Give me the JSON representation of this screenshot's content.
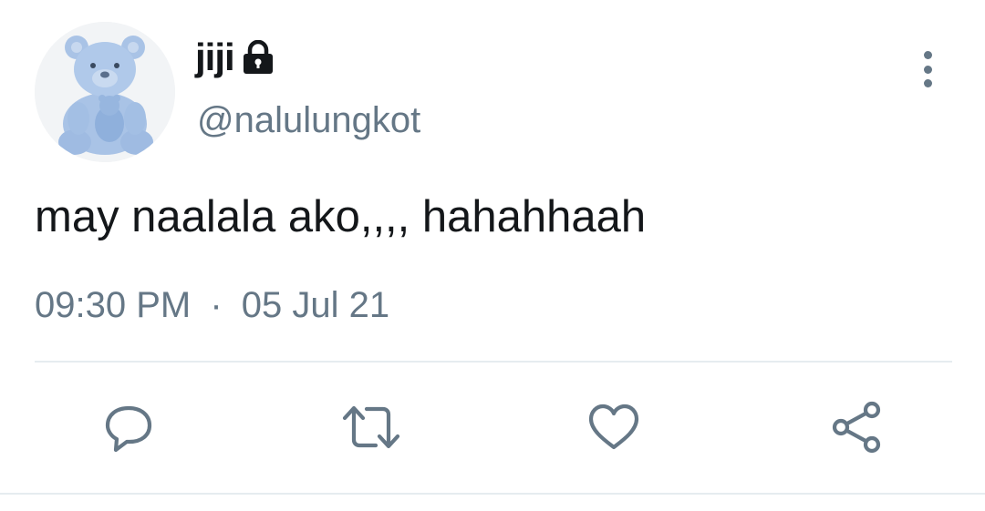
{
  "author": {
    "display_name": "jiji",
    "handle": "@nalulungkot",
    "protected_icon": "lock-icon",
    "avatar_desc_icon": "teddy-bear-avatar"
  },
  "tweet": {
    "text": "may naalala ako,,,, hahahhaah",
    "time": "09:30 PM",
    "separator": "·",
    "date": "05 Jul 21"
  },
  "actions": [
    {
      "name": "reply",
      "icon": "comment-icon"
    },
    {
      "name": "retweet",
      "icon": "retweet-icon"
    },
    {
      "name": "like",
      "icon": "heart-icon"
    },
    {
      "name": "share",
      "icon": "share-icon"
    }
  ],
  "colors": {
    "text_primary": "#14171a",
    "text_secondary": "#657786",
    "divider": "#e6ecf0",
    "avatar_bear": "#a9c3e6"
  }
}
